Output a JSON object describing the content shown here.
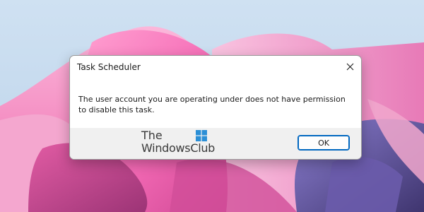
{
  "dialog": {
    "title": "Task Scheduler",
    "message": "The user account you are operating under does not have permission to disable this task.",
    "ok_label": "OK",
    "close_icon": "close-icon",
    "accent_color": "#0067c0"
  },
  "watermark": {
    "line1": "The",
    "line2": "WindowsClub",
    "logo_icon": "windows-logo-icon",
    "logo_color": "#2b8fd6"
  },
  "wallpaper": {
    "sky_color": "#c9dcef",
    "bloom_colors": [
      "#e85aa9",
      "#f7a8d2",
      "#b23d8a",
      "#5a4f9a"
    ]
  }
}
